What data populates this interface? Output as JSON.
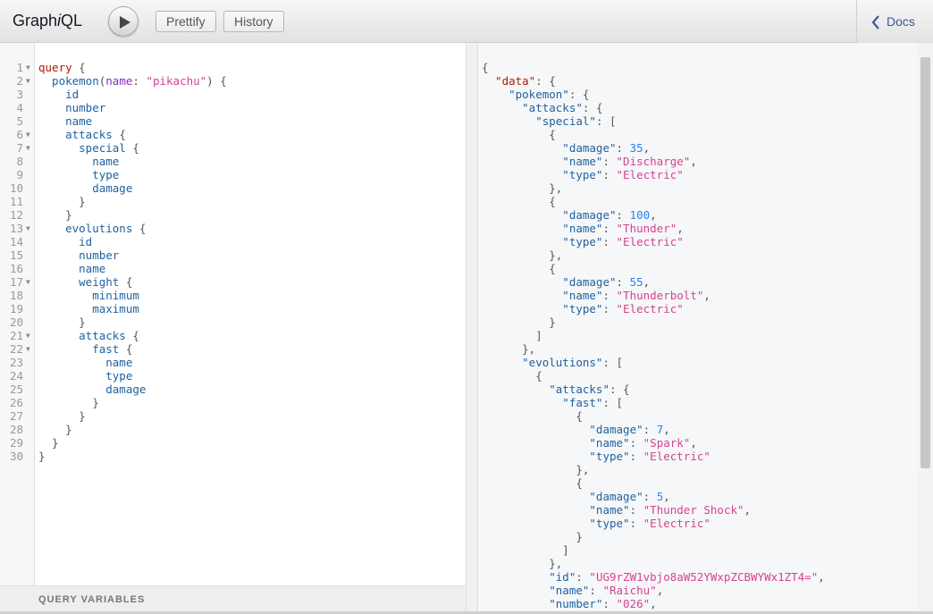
{
  "app": {
    "title_pre": "Graph",
    "title_italic": "i",
    "title_post": "QL"
  },
  "toolbar": {
    "prettify_label": "Prettify",
    "history_label": "History",
    "docs_label": "Docs"
  },
  "query_variables_label": "QUERY VARIABLES",
  "query_lines": [
    {
      "n": "1",
      "fold": true,
      "parts": [
        [
          "k",
          "query"
        ],
        [
          "p",
          " {"
        ]
      ]
    },
    {
      "n": "2",
      "fold": true,
      "parts": [
        [
          "d",
          "  pokemon"
        ],
        [
          "p",
          "("
        ],
        [
          "v",
          "name"
        ],
        [
          "p",
          ": "
        ],
        [
          "s",
          "\"pikachu\""
        ],
        [
          "p",
          ") {"
        ]
      ]
    },
    {
      "n": "3",
      "parts": [
        [
          "d",
          "    id"
        ]
      ]
    },
    {
      "n": "4",
      "parts": [
        [
          "d",
          "    number"
        ]
      ]
    },
    {
      "n": "5",
      "parts": [
        [
          "d",
          "    name"
        ]
      ]
    },
    {
      "n": "6",
      "fold": true,
      "parts": [
        [
          "d",
          "    attacks"
        ],
        [
          "p",
          " {"
        ]
      ]
    },
    {
      "n": "7",
      "fold": true,
      "parts": [
        [
          "d",
          "      special"
        ],
        [
          "p",
          " {"
        ]
      ]
    },
    {
      "n": "8",
      "parts": [
        [
          "d",
          "        name"
        ]
      ]
    },
    {
      "n": "9",
      "parts": [
        [
          "d",
          "        type"
        ]
      ]
    },
    {
      "n": "10",
      "parts": [
        [
          "d",
          "        damage"
        ]
      ]
    },
    {
      "n": "11",
      "parts": [
        [
          "p",
          "      }"
        ]
      ]
    },
    {
      "n": "12",
      "parts": [
        [
          "p",
          "    }"
        ]
      ]
    },
    {
      "n": "13",
      "fold": true,
      "parts": [
        [
          "d",
          "    evolutions"
        ],
        [
          "p",
          " {"
        ]
      ]
    },
    {
      "n": "14",
      "parts": [
        [
          "d",
          "      id"
        ]
      ]
    },
    {
      "n": "15",
      "parts": [
        [
          "d",
          "      number"
        ]
      ]
    },
    {
      "n": "16",
      "parts": [
        [
          "d",
          "      name"
        ]
      ]
    },
    {
      "n": "17",
      "fold": true,
      "parts": [
        [
          "d",
          "      weight"
        ],
        [
          "p",
          " {"
        ]
      ]
    },
    {
      "n": "18",
      "parts": [
        [
          "d",
          "        minimum"
        ]
      ]
    },
    {
      "n": "19",
      "parts": [
        [
          "d",
          "        maximum"
        ]
      ]
    },
    {
      "n": "20",
      "parts": [
        [
          "p",
          "      }"
        ]
      ]
    },
    {
      "n": "21",
      "fold": true,
      "parts": [
        [
          "d",
          "      attacks"
        ],
        [
          "p",
          " {"
        ]
      ]
    },
    {
      "n": "22",
      "fold": true,
      "parts": [
        [
          "d",
          "        fast"
        ],
        [
          "p",
          " {"
        ]
      ]
    },
    {
      "n": "23",
      "parts": [
        [
          "d",
          "          name"
        ]
      ]
    },
    {
      "n": "24",
      "parts": [
        [
          "d",
          "          type"
        ]
      ]
    },
    {
      "n": "25",
      "parts": [
        [
          "d",
          "          damage"
        ]
      ]
    },
    {
      "n": "26",
      "parts": [
        [
          "p",
          "        }"
        ]
      ]
    },
    {
      "n": "27",
      "parts": [
        [
          "p",
          "      }"
        ]
      ]
    },
    {
      "n": "28",
      "parts": [
        [
          "p",
          "    }"
        ]
      ]
    },
    {
      "n": "29",
      "parts": [
        [
          "p",
          "  }"
        ]
      ]
    },
    {
      "n": "30",
      "parts": [
        [
          "p",
          "}"
        ]
      ]
    }
  ],
  "result_lines": [
    {
      "fold": true,
      "parts": [
        [
          "p",
          "{"
        ]
      ]
    },
    {
      "fold": true,
      "parts": [
        [
          "k",
          "  \"data\""
        ],
        [
          "p",
          ": {"
        ]
      ]
    },
    {
      "fold": true,
      "parts": [
        [
          "rk",
          "    \"pokemon\""
        ],
        [
          "p",
          ": {"
        ]
      ]
    },
    {
      "fold": true,
      "parts": [
        [
          "rk",
          "      \"attacks\""
        ],
        [
          "p",
          ": {"
        ]
      ]
    },
    {
      "fold": true,
      "parts": [
        [
          "rk",
          "        \"special\""
        ],
        [
          "p",
          ": ["
        ]
      ]
    },
    {
      "fold": true,
      "parts": [
        [
          "p",
          "          {"
        ]
      ]
    },
    {
      "parts": [
        [
          "rk",
          "            \"damage\""
        ],
        [
          "p",
          ": "
        ],
        [
          "n",
          "35"
        ],
        [
          "p",
          ","
        ]
      ]
    },
    {
      "parts": [
        [
          "rk",
          "            \"name\""
        ],
        [
          "p",
          ": "
        ],
        [
          "s",
          "\"Discharge\""
        ],
        [
          "p",
          ","
        ]
      ]
    },
    {
      "parts": [
        [
          "rk",
          "            \"type\""
        ],
        [
          "p",
          ": "
        ],
        [
          "s",
          "\"Electric\""
        ]
      ]
    },
    {
      "parts": [
        [
          "p",
          "          },"
        ]
      ]
    },
    {
      "fold": true,
      "parts": [
        [
          "p",
          "          {"
        ]
      ]
    },
    {
      "parts": [
        [
          "rk",
          "            \"damage\""
        ],
        [
          "p",
          ": "
        ],
        [
          "n",
          "100"
        ],
        [
          "p",
          ","
        ]
      ]
    },
    {
      "parts": [
        [
          "rk",
          "            \"name\""
        ],
        [
          "p",
          ": "
        ],
        [
          "s",
          "\"Thunder\""
        ],
        [
          "p",
          ","
        ]
      ]
    },
    {
      "parts": [
        [
          "rk",
          "            \"type\""
        ],
        [
          "p",
          ": "
        ],
        [
          "s",
          "\"Electric\""
        ]
      ]
    },
    {
      "parts": [
        [
          "p",
          "          },"
        ]
      ]
    },
    {
      "fold": true,
      "parts": [
        [
          "p",
          "          {"
        ]
      ]
    },
    {
      "parts": [
        [
          "rk",
          "            \"damage\""
        ],
        [
          "p",
          ": "
        ],
        [
          "n",
          "55"
        ],
        [
          "p",
          ","
        ]
      ]
    },
    {
      "parts": [
        [
          "rk",
          "            \"name\""
        ],
        [
          "p",
          ": "
        ],
        [
          "s",
          "\"Thunderbolt\""
        ],
        [
          "p",
          ","
        ]
      ]
    },
    {
      "parts": [
        [
          "rk",
          "            \"type\""
        ],
        [
          "p",
          ": "
        ],
        [
          "s",
          "\"Electric\""
        ]
      ]
    },
    {
      "parts": [
        [
          "p",
          "          }"
        ]
      ]
    },
    {
      "parts": [
        [
          "p",
          "        ]"
        ]
      ]
    },
    {
      "parts": [
        [
          "p",
          "      },"
        ]
      ]
    },
    {
      "fold": true,
      "parts": [
        [
          "rk",
          "      \"evolutions\""
        ],
        [
          "p",
          ": ["
        ]
      ]
    },
    {
      "fold": true,
      "parts": [
        [
          "p",
          "        {"
        ]
      ]
    },
    {
      "fold": true,
      "parts": [
        [
          "rk",
          "          \"attacks\""
        ],
        [
          "p",
          ": {"
        ]
      ]
    },
    {
      "fold": true,
      "parts": [
        [
          "rk",
          "            \"fast\""
        ],
        [
          "p",
          ": ["
        ]
      ]
    },
    {
      "fold": true,
      "parts": [
        [
          "p",
          "              {"
        ]
      ]
    },
    {
      "parts": [
        [
          "rk",
          "                \"damage\""
        ],
        [
          "p",
          ": "
        ],
        [
          "n",
          "7"
        ],
        [
          "p",
          ","
        ]
      ]
    },
    {
      "parts": [
        [
          "rk",
          "                \"name\""
        ],
        [
          "p",
          ": "
        ],
        [
          "s",
          "\"Spark\""
        ],
        [
          "p",
          ","
        ]
      ]
    },
    {
      "parts": [
        [
          "rk",
          "                \"type\""
        ],
        [
          "p",
          ": "
        ],
        [
          "s",
          "\"Electric\""
        ]
      ]
    },
    {
      "parts": [
        [
          "p",
          "              },"
        ]
      ]
    },
    {
      "fold": true,
      "parts": [
        [
          "p",
          "              {"
        ]
      ]
    },
    {
      "parts": [
        [
          "rk",
          "                \"damage\""
        ],
        [
          "p",
          ": "
        ],
        [
          "n",
          "5"
        ],
        [
          "p",
          ","
        ]
      ]
    },
    {
      "parts": [
        [
          "rk",
          "                \"name\""
        ],
        [
          "p",
          ": "
        ],
        [
          "s",
          "\"Thunder Shock\""
        ],
        [
          "p",
          ","
        ]
      ]
    },
    {
      "parts": [
        [
          "rk",
          "                \"type\""
        ],
        [
          "p",
          ": "
        ],
        [
          "s",
          "\"Electric\""
        ]
      ]
    },
    {
      "parts": [
        [
          "p",
          "              }"
        ]
      ]
    },
    {
      "parts": [
        [
          "p",
          "            ]"
        ]
      ]
    },
    {
      "parts": [
        [
          "p",
          "          },"
        ]
      ]
    },
    {
      "parts": [
        [
          "rk",
          "          \"id\""
        ],
        [
          "p",
          ": "
        ],
        [
          "s",
          "\"UG9rZW1vbjo8aW52YWxpZCBWYWx1ZT4=\""
        ],
        [
          "p",
          ","
        ]
      ]
    },
    {
      "parts": [
        [
          "rk",
          "          \"name\""
        ],
        [
          "p",
          ": "
        ],
        [
          "s",
          "\"Raichu\""
        ],
        [
          "p",
          ","
        ]
      ]
    },
    {
      "parts": [
        [
          "rk",
          "          \"number\""
        ],
        [
          "p",
          ": "
        ],
        [
          "s",
          "\"026\""
        ],
        [
          "p",
          ","
        ]
      ]
    }
  ]
}
